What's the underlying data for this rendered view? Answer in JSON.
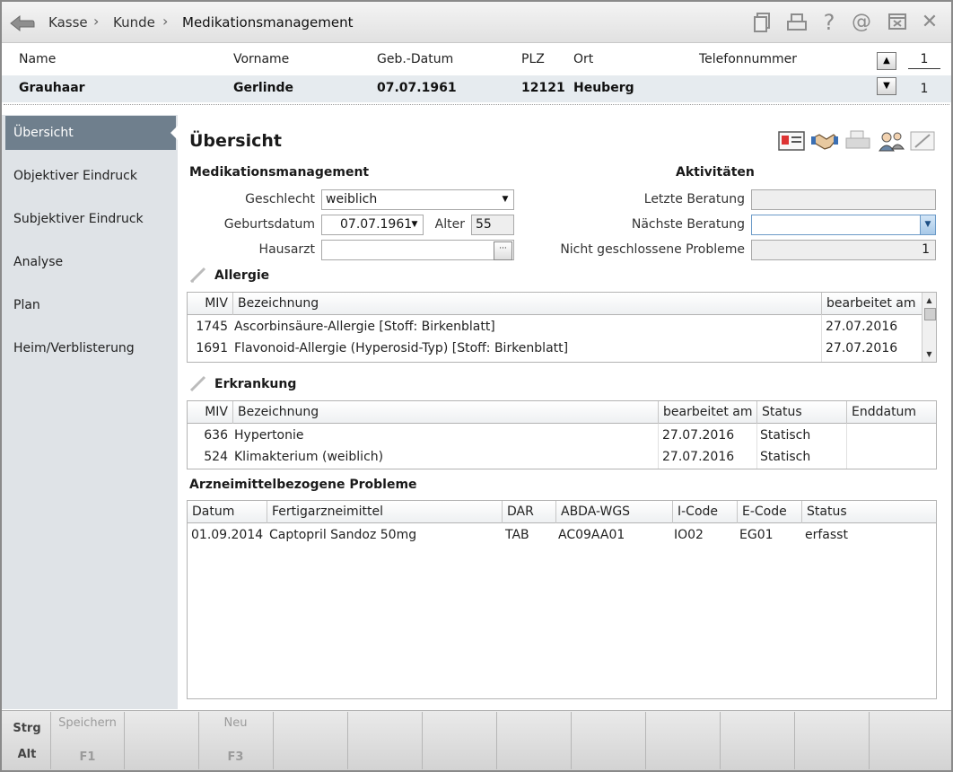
{
  "breadcrumb": {
    "items": [
      "Kasse",
      "Kunde",
      "Medikationsmanagement"
    ],
    "separator": "›"
  },
  "toolbar_icons": [
    "document-icon",
    "print-icon",
    "help-icon",
    "at-icon",
    "window-icon",
    "close-icon"
  ],
  "toolbar_glyphs": {
    "help": "?",
    "at": "@",
    "close": "✕"
  },
  "customer_header": {
    "columns": [
      "Name",
      "Vorname",
      "Geb.-Datum",
      "PLZ",
      "Ort",
      "Telefonnummer"
    ],
    "values": {
      "name": "Grauhaar",
      "vorname": "Gerlinde",
      "geb_datum": "07.07.1961",
      "plz": "12121",
      "ort": "Heuberg",
      "telefon": ""
    },
    "counter_top": "1",
    "counter_bottom": "1"
  },
  "sidebar": {
    "items": [
      {
        "label": "Übersicht",
        "active": true
      },
      {
        "label": "Objektiver Eindruck",
        "active": false
      },
      {
        "label": "Subjektiver Eindruck",
        "active": false
      },
      {
        "label": "Analyse",
        "active": false
      },
      {
        "label": "Plan",
        "active": false
      },
      {
        "label": "Heim/Verblisterung",
        "active": false
      }
    ]
  },
  "main": {
    "title": "Übersicht",
    "section_medikation": "Medikationsmanagement",
    "section_aktivitaeten": "Aktivitäten",
    "geschlecht_label": "Geschlecht",
    "geschlecht_value": "weiblich",
    "geburtsdatum_label": "Geburtsdatum",
    "geburtsdatum_value": "07.07.1961",
    "alter_label": "Alter",
    "alter_value": "55",
    "hausarzt_label": "Hausarzt",
    "hausarzt_value": "",
    "letzte_beratung_label": "Letzte Beratung",
    "letzte_beratung_value": "",
    "naechste_beratung_label": "Nächste Beratung",
    "naechste_beratung_value": "",
    "nicht_geschlossene_label": "Nicht geschlossene Probleme",
    "nicht_geschlossene_value": "1",
    "action_icons": [
      "patient-card-icon",
      "handshake-icon",
      "printer-icon",
      "consultation-icon",
      "document-edit-icon"
    ]
  },
  "allergie": {
    "title": "Allergie",
    "columns": [
      "MIV",
      "Bezeichnung",
      "bearbeitet am"
    ],
    "rows": [
      {
        "miv": "1745",
        "bezeichnung": "Ascorbinsäure-Allergie [Stoff: Birkenblatt]",
        "bearbeitet": "27.07.2016"
      },
      {
        "miv": "1691",
        "bezeichnung": "Flavonoid-Allergie (Hyperosid-Typ) [Stoff: Birkenblatt]",
        "bearbeitet": "27.07.2016"
      }
    ]
  },
  "erkrankung": {
    "title": "Erkrankung",
    "columns": [
      "MIV",
      "Bezeichnung",
      "bearbeitet am",
      "Status",
      "Enddatum"
    ],
    "rows": [
      {
        "miv": "636",
        "bezeichnung": "Hypertonie",
        "bearbeitet": "27.07.2016",
        "status": "Statisch",
        "enddatum": ""
      },
      {
        "miv": "524",
        "bezeichnung": "Klimakterium (weiblich)",
        "bearbeitet": "27.07.2016",
        "status": "Statisch",
        "enddatum": ""
      }
    ]
  },
  "probleme": {
    "title": "Arzneimittelbezogene Probleme",
    "columns": [
      "Datum",
      "Fertigarzneimittel",
      "DAR",
      "ABDA-WGS",
      "I-Code",
      "E-Code",
      "Status"
    ],
    "rows": [
      {
        "datum": "01.09.2014",
        "fertigarzneimittel": "Captopril Sandoz 50mg",
        "dar": "TAB",
        "abda": "AC09AA01",
        "icode": "IO02",
        "ecode": "EG01",
        "status": "erfasst"
      }
    ]
  },
  "function_keys": {
    "strg": "Strg",
    "alt": "Alt",
    "keys": [
      {
        "label": "Speichern",
        "key": "F1"
      },
      {
        "label": "",
        "key": ""
      },
      {
        "label": "Neu",
        "key": "F3"
      },
      {
        "label": "",
        "key": ""
      },
      {
        "label": "",
        "key": ""
      },
      {
        "label": "",
        "key": ""
      },
      {
        "label": "",
        "key": ""
      },
      {
        "label": "",
        "key": ""
      },
      {
        "label": "",
        "key": ""
      },
      {
        "label": "",
        "key": ""
      },
      {
        "label": "",
        "key": ""
      },
      {
        "label": "",
        "key": ""
      }
    ]
  }
}
